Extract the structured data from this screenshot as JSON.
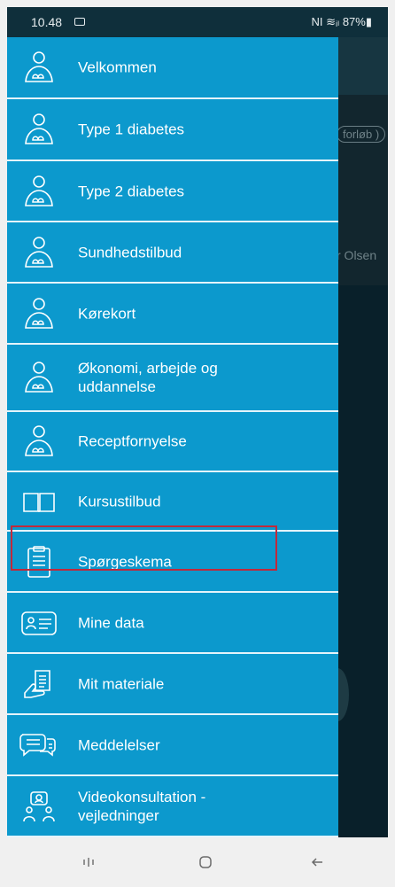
{
  "status_bar": {
    "time": "10.48",
    "right": "NI ≋ᵢₗ 87%▮",
    "battery": "87%"
  },
  "background": {
    "chip": "forløb )",
    "name": "r Olsen"
  },
  "menu": {
    "items": [
      {
        "label": "Velkommen",
        "icon": "person-icon"
      },
      {
        "label": "Type 1 diabetes",
        "icon": "person-icon"
      },
      {
        "label": "Type 2 diabetes",
        "icon": "person-icon"
      },
      {
        "label": "Sundhedstilbud",
        "icon": "person-icon"
      },
      {
        "label": "Kørekort",
        "icon": "person-icon"
      },
      {
        "label": "Økonomi, arbejde og uddannelse",
        "icon": "person-icon"
      },
      {
        "label": "Receptfornyelse",
        "icon": "person-icon"
      },
      {
        "label": "Kursustilbud",
        "icon": "book-icon"
      },
      {
        "label": "Spørgeskema",
        "icon": "clipboard-icon",
        "highlighted": true
      },
      {
        "label": "Mine data",
        "icon": "id-card-icon"
      },
      {
        "label": "Mit materiale",
        "icon": "document-hand-icon"
      },
      {
        "label": "Meddelelser",
        "icon": "chat-icon"
      },
      {
        "label": "Videokonsultation - vejledninger",
        "icon": "video-consult-icon"
      }
    ]
  },
  "highlight_color": "#c0293b",
  "drawer_color": "#0c99cd"
}
